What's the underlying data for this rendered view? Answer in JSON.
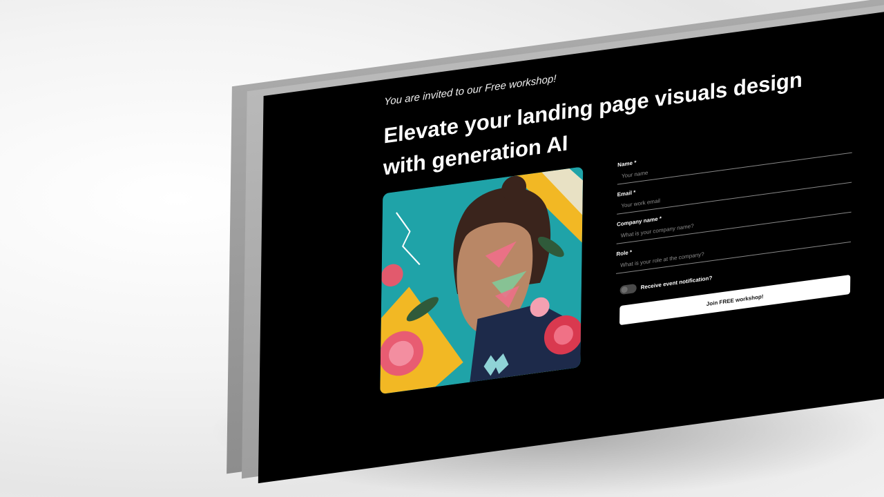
{
  "invite_text": "You are invited to our Free workshop!",
  "headline": "Elevate your landing page visuals design with generation AI",
  "hero_image": {
    "alt": "Portrait of a man with hair bun surrounded by flowers and colorful geometric shapes",
    "colors": {
      "teal": "#1fa3a8",
      "yellow": "#f2b824",
      "pink": "#ef6f8a",
      "skin": "#b98766",
      "hair": "#3a241c"
    }
  },
  "form": {
    "fields": [
      {
        "label": "Name *",
        "placeholder": "Your name"
      },
      {
        "label": "Email *",
        "placeholder": "Your work email"
      },
      {
        "label": "Company name *",
        "placeholder": "What is your company name?"
      },
      {
        "label": "Role *",
        "placeholder": "What is your role at the company?"
      }
    ],
    "toggle_label": "Receive event notification?",
    "toggle_on": false,
    "submit_label": "Join FREE workshop!"
  }
}
